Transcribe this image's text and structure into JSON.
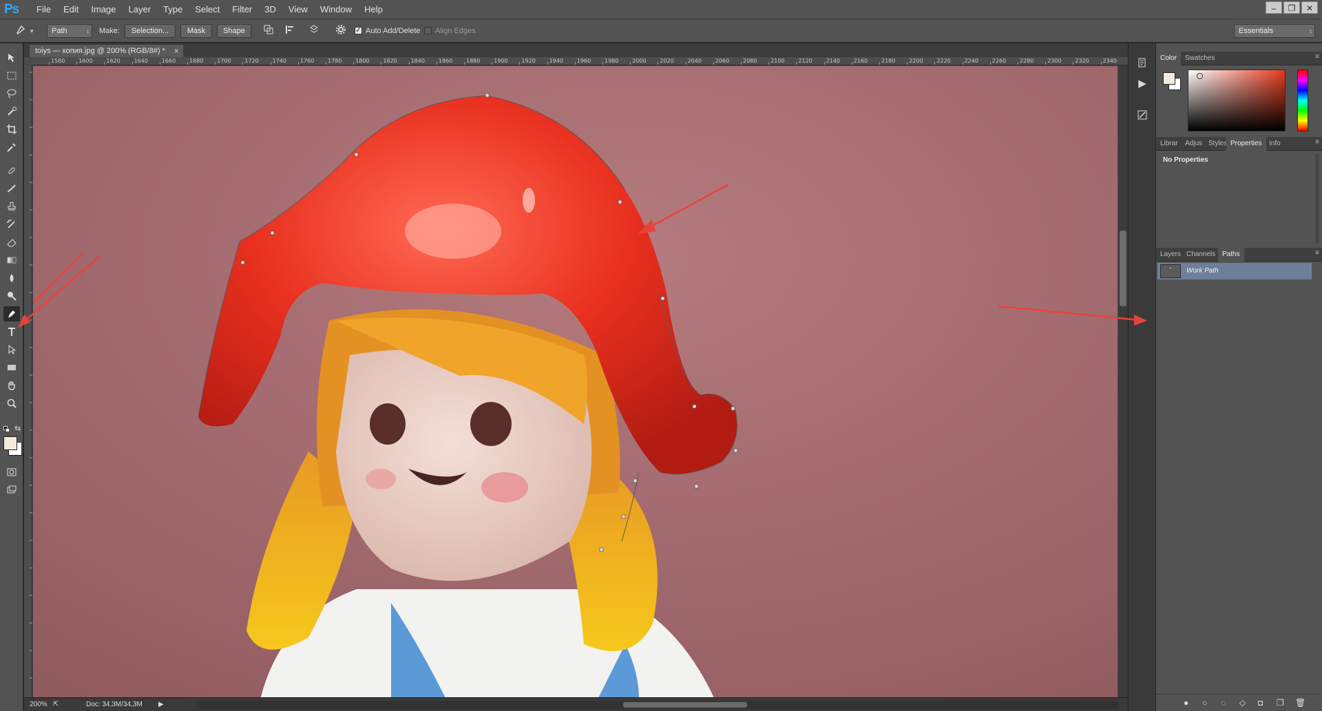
{
  "app": {
    "logo": "Ps"
  },
  "menu": [
    "File",
    "Edit",
    "Image",
    "Layer",
    "Type",
    "Select",
    "Filter",
    "3D",
    "View",
    "Window",
    "Help"
  ],
  "window_controls": {
    "minimize": "–",
    "restore": "❐",
    "close": "✕"
  },
  "options": {
    "mode_value": "Path",
    "make_label": "Make:",
    "selection_button": "Selection...",
    "mask_button": "Mask",
    "shape_button": "Shape",
    "auto_add_delete_label": "Auto Add/Delete",
    "auto_add_delete_checked": true,
    "align_edges_label": "Align Edges",
    "align_edges_checked": false,
    "workspace_value": "Essentials"
  },
  "document": {
    "tab_title": "toiys — копия.jpg @ 200% (RGB/8#) *",
    "tab_close": "×",
    "ruler_h": [
      "1580",
      "1600",
      "1620",
      "1640",
      "1660",
      "1680",
      "1700",
      "1720",
      "1740",
      "1760",
      "1780",
      "1800",
      "1820",
      "1840",
      "1860",
      "1880",
      "1900",
      "1920",
      "1940",
      "1960",
      "1980",
      "2000",
      "2020",
      "2040",
      "2060",
      "2080",
      "2100",
      "2120",
      "2140",
      "2160",
      "2180",
      "2200",
      "2220",
      "2240",
      "2260",
      "2280",
      "2300",
      "2320",
      "2340"
    ],
    "zoom": "200%",
    "doc_size": "Doc: 34,3M/34,3M"
  },
  "panels": {
    "color_tabs": [
      "Color",
      "Swatches"
    ],
    "properties_tabs": [
      "Librar",
      "Adjus",
      "Styles",
      "Properties",
      "Info"
    ],
    "properties_message": "No Properties",
    "paths_tabs": [
      "Layers",
      "Channels",
      "Paths"
    ],
    "paths": [
      {
        "name": "Work Path",
        "selected": true
      }
    ]
  },
  "colors": {
    "foreground": "#f3ead8",
    "background": "#ffffff",
    "accent_selection": "#6e7f99",
    "annotation_arrow": "#e8433a"
  },
  "icons": {
    "tools": [
      "move-icon",
      "marquee-icon",
      "lasso-icon",
      "quick-selection-icon",
      "crop-icon",
      "eyedropper-icon",
      "healing-brush-icon",
      "brush-icon",
      "clone-stamp-icon",
      "history-brush-icon",
      "eraser-icon",
      "gradient-icon",
      "blur-icon",
      "dodge-icon",
      "pen-icon",
      "type-icon",
      "path-selection-icon",
      "rectangle-icon",
      "hand-icon",
      "zoom-icon"
    ]
  }
}
